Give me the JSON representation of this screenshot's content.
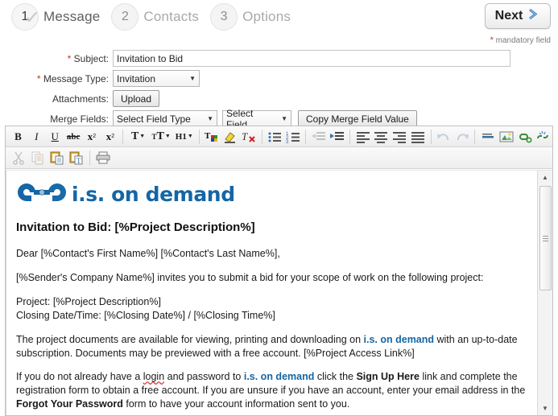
{
  "wizard": {
    "steps": [
      {
        "number": "1",
        "label": "Message",
        "state": "active",
        "checked": true
      },
      {
        "number": "2",
        "label": "Contacts",
        "state": "inactive",
        "checked": false
      },
      {
        "number": "3",
        "label": "Options",
        "state": "inactive",
        "checked": false
      }
    ],
    "next_label": "Next",
    "next_icon": "chevron-right-icon",
    "mandatory_star": "*",
    "mandatory_note": "mandatory field"
  },
  "form": {
    "subject": {
      "label": "Subject:",
      "required_star": "*",
      "value": "Invitation to Bid",
      "placeholder": ""
    },
    "message_type": {
      "label": "Message Type:",
      "required_star": "*",
      "value": "Invitation"
    },
    "attachments": {
      "label": "Attachments:",
      "upload_label": "Upload"
    },
    "merge_fields": {
      "label": "Merge Fields:",
      "field_type_value": "Select Field Type",
      "field_value": "Select Field",
      "copy_label": "Copy Merge Field Value"
    }
  },
  "toolbar": {
    "row1": [
      {
        "name": "bold-icon",
        "glyph": "B",
        "kind": "bold"
      },
      {
        "name": "italic-icon",
        "glyph": "I",
        "kind": "italic"
      },
      {
        "name": "underline-icon",
        "glyph": "U",
        "kind": "underline"
      },
      {
        "name": "strikethrough-icon",
        "glyph": "abc",
        "kind": "strike"
      },
      {
        "name": "subscript-icon",
        "glyph": "x",
        "kind": "sub",
        "sup": "2"
      },
      {
        "name": "superscript-icon",
        "glyph": "x",
        "kind": "sup",
        "sup": "2"
      },
      {
        "sep": true
      },
      {
        "name": "font-name-icon",
        "glyph": "T",
        "kind": "menu"
      },
      {
        "name": "font-size-icon",
        "glyph": "TT",
        "kind": "menu"
      },
      {
        "name": "heading-icon",
        "glyph": "H1",
        "kind": "menu"
      },
      {
        "sep": true
      },
      {
        "name": "text-color-icon",
        "glyph": "T",
        "kind": "color"
      },
      {
        "name": "highlight-color-icon",
        "glyph": "marker",
        "kind": "highlight"
      },
      {
        "name": "remove-format-icon",
        "glyph": "T",
        "kind": "removeformat"
      },
      {
        "sep": true
      },
      {
        "name": "bullet-list-icon",
        "glyph": "list",
        "kind": "ul"
      },
      {
        "name": "numbered-list-icon",
        "glyph": "list",
        "kind": "ol"
      },
      {
        "sep": true
      },
      {
        "name": "outdent-icon",
        "glyph": "outdent",
        "kind": "outdent",
        "dim": true
      },
      {
        "name": "indent-icon",
        "glyph": "indent",
        "kind": "indent"
      },
      {
        "sep": true
      },
      {
        "name": "align-left-icon",
        "glyph": "align",
        "kind": "alignleft"
      },
      {
        "name": "align-center-icon",
        "glyph": "align",
        "kind": "aligncenter"
      },
      {
        "name": "align-right-icon",
        "glyph": "align",
        "kind": "alignright"
      },
      {
        "name": "align-justify-icon",
        "glyph": "align",
        "kind": "alignjustify"
      },
      {
        "sep": true
      },
      {
        "name": "undo-icon",
        "glyph": "undo",
        "kind": "undo",
        "dim": true
      },
      {
        "name": "redo-icon",
        "glyph": "redo",
        "kind": "redo",
        "dim": true
      },
      {
        "sep": true
      },
      {
        "name": "horizontal-rule-icon",
        "glyph": "hr",
        "kind": "hr"
      },
      {
        "name": "insert-image-icon",
        "glyph": "image",
        "kind": "image"
      },
      {
        "name": "insert-link-icon",
        "glyph": "link",
        "kind": "link"
      },
      {
        "name": "unlink-icon",
        "glyph": "unlink",
        "kind": "unlink"
      }
    ],
    "row2": [
      {
        "name": "cut-icon",
        "glyph": "scissors",
        "kind": "cut",
        "dim": true
      },
      {
        "name": "copy-icon",
        "glyph": "copy",
        "kind": "copy",
        "dim": true
      },
      {
        "name": "paste-icon",
        "glyph": "clipboard",
        "kind": "paste"
      },
      {
        "name": "paste-as-text-icon",
        "glyph": "clipboard-t",
        "kind": "pastetext"
      },
      {
        "sep": true
      },
      {
        "name": "print-icon",
        "glyph": "printer",
        "kind": "print"
      }
    ]
  },
  "email": {
    "logo_alt": "i.s. on demand logo",
    "logo_text": "i.s. on demand",
    "logo_color": "#1466a5",
    "title": "Invitation to Bid: [%Project Description%]",
    "greeting": "Dear [%Contact's First Name%] [%Contact's Last Name%],",
    "p_invite": "[%Sender's Company Name%] invites you to submit a bid for your scope of work on the following project:",
    "project_line": "Project: [%Project Description%]",
    "closing_line": "Closing Date/Time: [%Closing Date%] / [%Closing Time%]",
    "p_docs_a": "The project documents are available for viewing, printing and downloading on ",
    "p_docs_brand": "i.s. on demand",
    "p_docs_b": " with an up-to-date subscription. Documents may be previewed with a free account. [%Project Access Link%]",
    "p_login_a": "If you do not already have a ",
    "p_login_spell": "login",
    "p_login_b": " and password to ",
    "p_login_brand": "i.s. on demand",
    "p_login_c": " click the ",
    "p_login_bold1": "Sign Up Here",
    "p_login_d": " link and complete the registration form to obtain a free account. If you are unsure if you have an account, enter your email address in the ",
    "p_login_bold2": "Forgot Your Password",
    "p_login_e": " form to have your account information sent to you."
  },
  "scrollbar": {
    "up_icon": "triangle-up-icon",
    "down_icon": "triangle-down-icon"
  }
}
